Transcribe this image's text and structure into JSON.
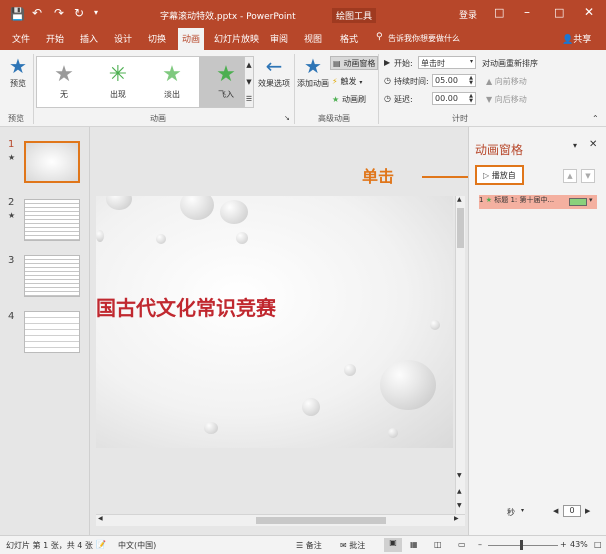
{
  "titlebar": {
    "title": "字幕滚动特效.pptx - PowerPoint",
    "context_tab": "绘图工具",
    "login": "登录",
    "icons": [
      "save-icon",
      "undo-icon",
      "redo-icon",
      "repeat-icon",
      "customize-icon"
    ]
  },
  "tabs": [
    "文件",
    "开始",
    "插入",
    "设计",
    "切换",
    "动画",
    "幻灯片放映",
    "审阅",
    "视图",
    "格式"
  ],
  "active_tab": "动画",
  "tell_me": "告诉我你想要做什么",
  "share": "共享",
  "ribbon": {
    "preview": "预览",
    "preview_group": "预览",
    "gallery": [
      "无",
      "出现",
      "淡出",
      "飞入"
    ],
    "effect_options": "效果选项",
    "animation_group": "动画",
    "add_animation": "添加动画",
    "animation_pane": "动画窗格",
    "trigger": "触发",
    "animation_painter": "动画刷",
    "advanced_group": "高级动画",
    "start_label": "开始:",
    "start_value": "单击时",
    "duration_label": "持续时间:",
    "duration_value": "05.00",
    "delay_label": "延迟:",
    "delay_value": "00.00",
    "timing_group": "计时",
    "reorder_label": "对动画重新排序",
    "move_earlier": "向前移动",
    "move_later": "向后移动"
  },
  "thumbnails": [
    {
      "num": "1",
      "star": "★"
    },
    {
      "num": "2",
      "star": "★"
    },
    {
      "num": "3",
      "star": ""
    },
    {
      "num": "4",
      "star": ""
    }
  ],
  "slide": {
    "title": "国古代文化常识竞赛"
  },
  "animation_pane": {
    "title": "动画窗格",
    "play_button": "播放自",
    "item_label": "标题 1: 第十届中..."
  },
  "callout": "单击",
  "seconds": "秒",
  "seconds_value": "0",
  "statusbar": {
    "slide_info": "幻灯片 第 1 张，共 4 张",
    "language": "中文(中国)",
    "notes": "备注",
    "comments": "批注",
    "zoom": "43%"
  },
  "colors": {
    "brand": "#b7472a",
    "accent_orange": "#e0761a",
    "title_red": "#c0282f",
    "item_bg": "#f4b0a0",
    "item_green": "#8bd17c"
  }
}
